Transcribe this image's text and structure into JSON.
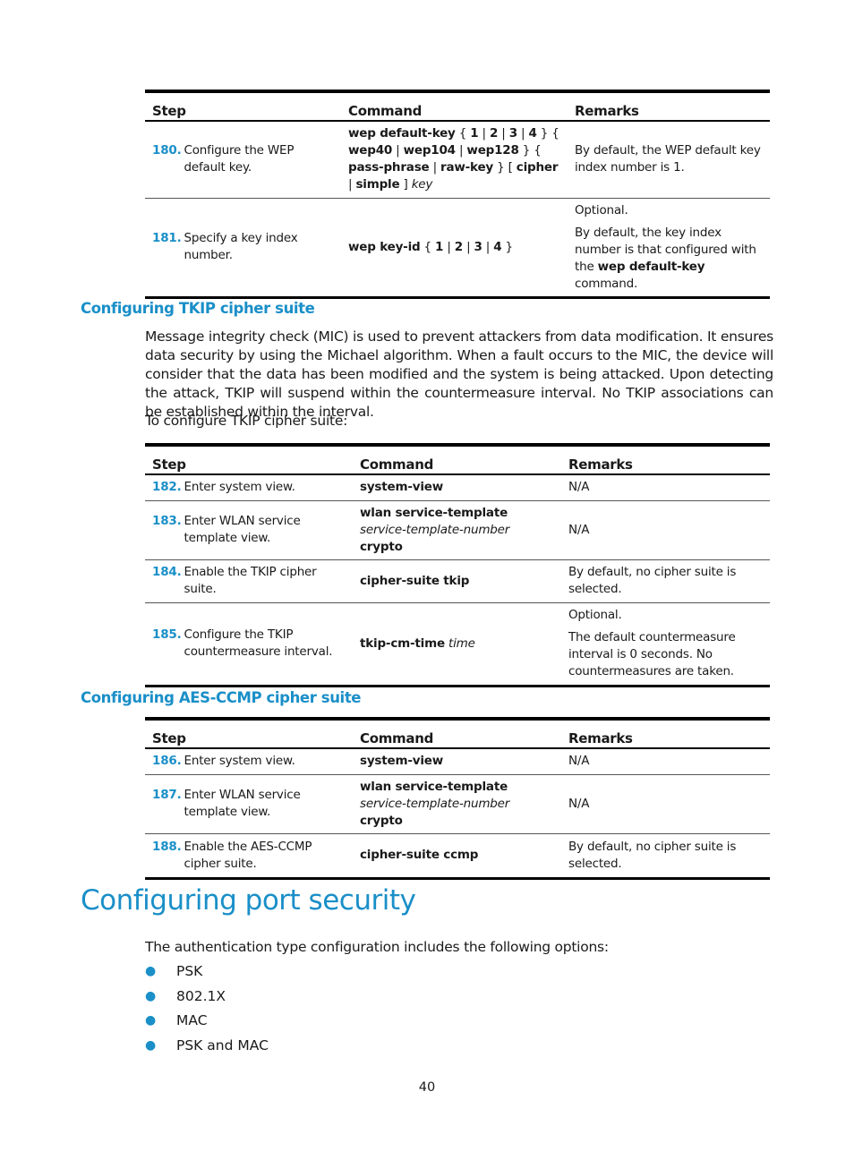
{
  "colors": {
    "accent": "#1a8fc8",
    "text": "#1a1a1a"
  },
  "table_headers": {
    "step": "Step",
    "command": "Command",
    "remarks": "Remarks"
  },
  "wep_table": {
    "rows": [
      {
        "num": "180.",
        "step": "Configure the WEP default key.",
        "cmd": [
          {
            "t": "wep default-key",
            "s": "b"
          },
          {
            "t": " { ",
            "s": ""
          },
          {
            "t": "1",
            "s": "b"
          },
          {
            "t": " | ",
            "s": ""
          },
          {
            "t": "2",
            "s": "b"
          },
          {
            "t": " | ",
            "s": ""
          },
          {
            "t": "3",
            "s": "b"
          },
          {
            "t": " | ",
            "s": ""
          },
          {
            "t": "4",
            "s": "b"
          },
          {
            "t": " } { ",
            "s": ""
          },
          {
            "t": "wep40",
            "s": "b"
          },
          {
            "t": " | ",
            "s": ""
          },
          {
            "t": "wep104",
            "s": "b"
          },
          {
            "t": " | ",
            "s": ""
          },
          {
            "t": "wep128",
            "s": "b"
          },
          {
            "t": " } { ",
            "s": ""
          },
          {
            "t": "pass-phrase",
            "s": "b"
          },
          {
            "t": " | ",
            "s": ""
          },
          {
            "t": "raw-key",
            "s": "b"
          },
          {
            "t": " } [ ",
            "s": ""
          },
          {
            "t": "cipher",
            "s": "b"
          },
          {
            "t": " | ",
            "s": ""
          },
          {
            "t": "simple",
            "s": "b"
          },
          {
            "t": " ] ",
            "s": ""
          },
          {
            "t": "key",
            "s": "i"
          }
        ],
        "remarks": [
          [
            {
              "t": "By default, the WEP default key index number is 1.",
              "s": ""
            }
          ]
        ]
      },
      {
        "num": "181.",
        "step": "Specify a key index number.",
        "cmd": [
          {
            "t": "wep key-id",
            "s": "b"
          },
          {
            "t": " { ",
            "s": ""
          },
          {
            "t": "1",
            "s": "b"
          },
          {
            "t": " | ",
            "s": ""
          },
          {
            "t": "2",
            "s": "b"
          },
          {
            "t": " | ",
            "s": ""
          },
          {
            "t": "3",
            "s": "b"
          },
          {
            "t": " | ",
            "s": ""
          },
          {
            "t": "4",
            "s": "b"
          },
          {
            "t": " }",
            "s": ""
          }
        ],
        "remarks": [
          [
            {
              "t": "Optional.",
              "s": ""
            }
          ],
          [
            {
              "t": "By default, the key index number is that configured with the ",
              "s": ""
            },
            {
              "t": "wep default-key",
              "s": "b"
            },
            {
              "t": " command.",
              "s": ""
            }
          ]
        ]
      }
    ]
  },
  "tkip_section": {
    "heading": "Configuring TKIP cipher suite",
    "paragraph": "Message integrity check (MIC) is used to prevent attackers from data modification. It ensures data security by using the Michael algorithm. When a fault occurs to the MIC, the device will consider that the data has been modified and the system is being attacked. Upon detecting the attack, TKIP will suspend within the countermeasure interval. No TKIP associations can be established within the interval.",
    "intro": "To configure TKIP cipher suite:",
    "rows": [
      {
        "num": "182.",
        "step": "Enter system view.",
        "cmd": [
          {
            "t": "system-view",
            "s": "b"
          }
        ],
        "remarks": [
          [
            {
              "t": "N/A",
              "s": ""
            }
          ]
        ]
      },
      {
        "num": "183.",
        "step": "Enter WLAN service template view.",
        "cmd": [
          {
            "t": "wlan service-template",
            "s": "b"
          },
          {
            "t": " ",
            "s": ""
          },
          {
            "t": "service-template-number",
            "s": "i"
          },
          {
            "t": " ",
            "s": ""
          },
          {
            "t": "crypto",
            "s": "b"
          }
        ],
        "remarks": [
          [
            {
              "t": "N/A",
              "s": ""
            }
          ]
        ]
      },
      {
        "num": "184.",
        "step": "Enable the TKIP cipher suite.",
        "cmd": [
          {
            "t": "cipher-suite tkip",
            "s": "b"
          }
        ],
        "remarks": [
          [
            {
              "t": "By default, no cipher suite is selected.",
              "s": ""
            }
          ]
        ]
      },
      {
        "num": "185.",
        "step": "Configure the TKIP countermeasure interval.",
        "cmd": [
          {
            "t": "tkip-cm-time",
            "s": "b"
          },
          {
            "t": " ",
            "s": ""
          },
          {
            "t": "time",
            "s": "i"
          }
        ],
        "remarks": [
          [
            {
              "t": "Optional.",
              "s": ""
            }
          ],
          [
            {
              "t": "The default countermeasure interval is 0 seconds. No countermeasures are taken.",
              "s": ""
            }
          ]
        ]
      }
    ]
  },
  "ccmp_section": {
    "heading": "Configuring AES-CCMP cipher suite",
    "rows": [
      {
        "num": "186.",
        "step": "Enter system view.",
        "cmd": [
          {
            "t": "system-view",
            "s": "b"
          }
        ],
        "remarks": [
          [
            {
              "t": "N/A",
              "s": ""
            }
          ]
        ]
      },
      {
        "num": "187.",
        "step": "Enter WLAN service template view.",
        "cmd": [
          {
            "t": "wlan service-template",
            "s": "b"
          },
          {
            "t": " ",
            "s": ""
          },
          {
            "t": "service-template-number",
            "s": "i"
          },
          {
            "t": " ",
            "s": ""
          },
          {
            "t": "crypto",
            "s": "b"
          }
        ],
        "remarks": [
          [
            {
              "t": "N/A",
              "s": ""
            }
          ]
        ]
      },
      {
        "num": "188.",
        "step": "Enable the AES-CCMP cipher suite.",
        "cmd": [
          {
            "t": "cipher-suite ccmp",
            "s": "b"
          }
        ],
        "remarks": [
          [
            {
              "t": "By default, no cipher suite is selected.",
              "s": ""
            }
          ]
        ]
      }
    ]
  },
  "port_security": {
    "heading": "Configuring port security",
    "intro": "The authentication type configuration includes the following options:",
    "bullet_icon": "bullet-dot",
    "options": [
      "PSK",
      "802.1X",
      "MAC",
      "PSK and MAC"
    ]
  },
  "page_number": "40"
}
